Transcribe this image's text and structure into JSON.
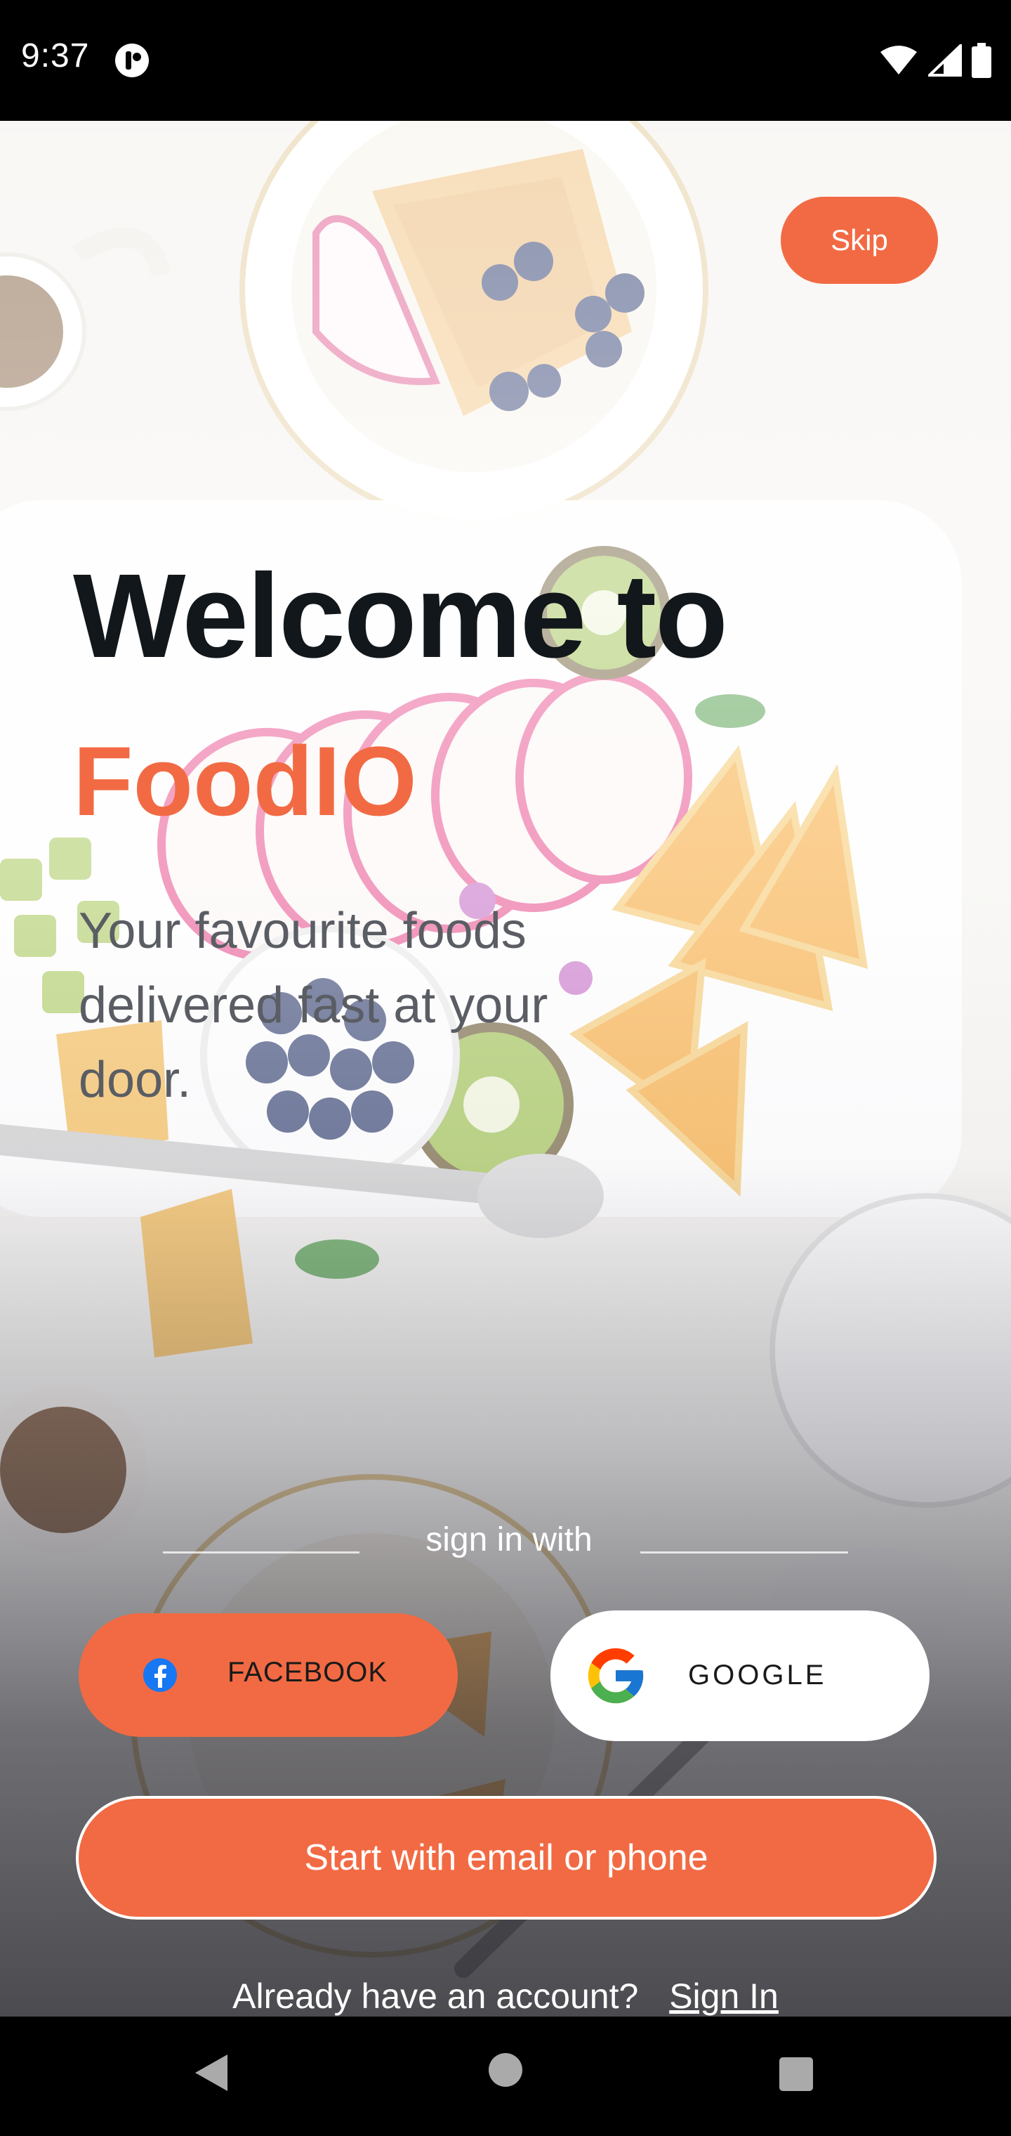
{
  "status_bar": {
    "time": "9:37"
  },
  "header": {
    "skip_label": "Skip"
  },
  "hero": {
    "welcome": "Welcome to",
    "brand": "FoodIO",
    "tagline": "Your favourite foods delivered fast at your door."
  },
  "auth": {
    "sign_in_with": "sign in with",
    "facebook_label": "FACEBOOK",
    "google_label": "GOOGLE",
    "email_label": "Start with email or phone",
    "account_prompt": "Already have an account?",
    "sign_in_link": "Sign In"
  },
  "colors": {
    "accent": "#f26a43",
    "title": "#12171b",
    "tagline": "#5a5d63"
  },
  "icons": {
    "facebook": "facebook-icon",
    "google": "google-icon",
    "back": "back-triangle-icon",
    "home": "home-circle-icon",
    "recent": "recent-square-icon"
  }
}
